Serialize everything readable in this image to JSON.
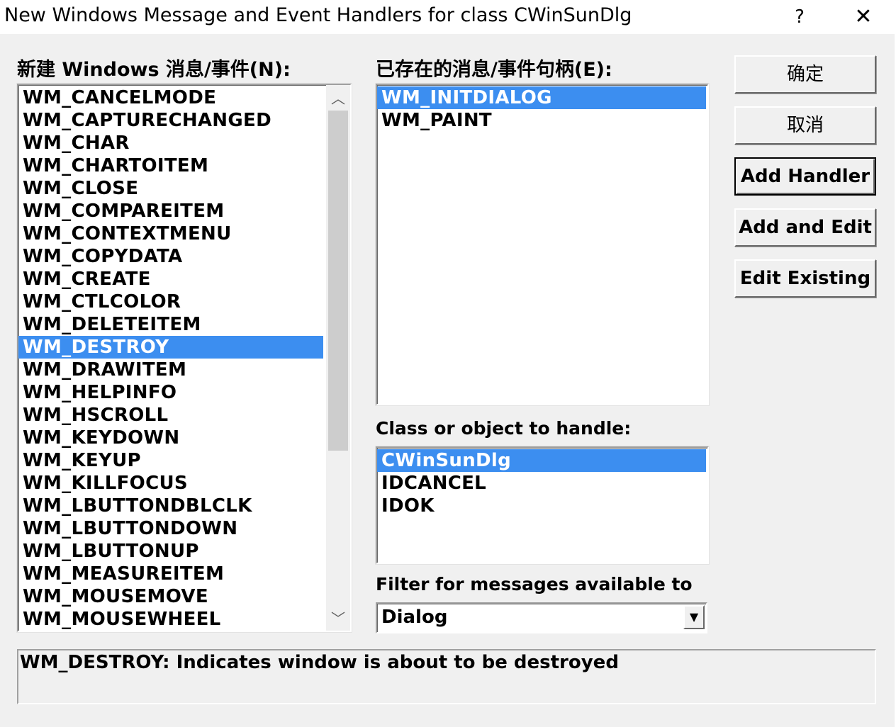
{
  "window": {
    "title": "New Windows Message and Event Handlers for class CWinSunDlg",
    "help_glyph": "?",
    "close_glyph": "✕"
  },
  "new_messages": {
    "label": "新建 Windows 消息/事件(N):",
    "items": [
      "WM_CANCELMODE",
      "WM_CAPTURECHANGED",
      "WM_CHAR",
      "WM_CHARTOITEM",
      "WM_CLOSE",
      "WM_COMPAREITEM",
      "WM_CONTEXTMENU",
      "WM_COPYDATA",
      "WM_CREATE",
      "WM_CTLCOLOR",
      "WM_DELETEITEM",
      "WM_DESTROY",
      "WM_DRAWITEM",
      "WM_HELPINFO",
      "WM_HSCROLL",
      "WM_KEYDOWN",
      "WM_KEYUP",
      "WM_KILLFOCUS",
      "WM_LBUTTONDBLCLK",
      "WM_LBUTTONDOWN",
      "WM_LBUTTONUP",
      "WM_MEASUREITEM",
      "WM_MOUSEMOVE",
      "WM_MOUSEWHEEL"
    ],
    "selected_index": 11
  },
  "existing_handlers": {
    "label": "已存在的消息/事件句柄(E):",
    "items": [
      "WM_INITDIALOG",
      "WM_PAINT"
    ],
    "selected_index": 0
  },
  "class_object": {
    "label": "Class or object to handle:",
    "items": [
      "CWinSunDlg",
      "IDCANCEL",
      "IDOK"
    ],
    "selected_index": 0
  },
  "filter": {
    "label": "Filter for messages available to",
    "value": "Dialog"
  },
  "buttons": {
    "ok": "确定",
    "cancel": "取消",
    "add_handler": "Add Handler",
    "add_and_edit": "Add and Edit",
    "edit_existing": "Edit Existing"
  },
  "description": "WM_DESTROY:  Indicates window is about to be destroyed",
  "colors": {
    "selection": "#3c8ef0",
    "face": "#f0f0f0"
  }
}
